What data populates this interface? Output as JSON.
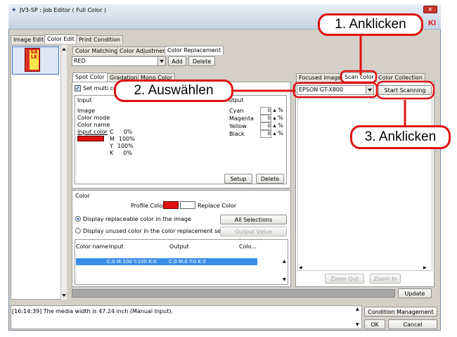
{
  "window": {
    "title": "JV3-SP : Job Editor ( Full Color )",
    "close_glyph": "✕",
    "logo": "KI"
  },
  "main_tabs": [
    "Image Edit",
    "Color Edit",
    "Print Condition"
  ],
  "thumbnail": {
    "text": "SALE"
  },
  "sub_tabs": [
    "Color Matching",
    "Color Adjustment",
    "Color Replacement"
  ],
  "replacement": {
    "selected": "RED",
    "add_label": "Add",
    "delete_label": "Delete"
  },
  "spot_tabs": [
    "Spot Color",
    "Gradation",
    "Mono Color"
  ],
  "set_multi": {
    "label": "Set multi co"
  },
  "input_group": {
    "title": "Input",
    "image_label": "Image",
    "mode_label": "Color mode",
    "name_label": "Color name",
    "input_color_label": "Input color",
    "cmyk": [
      {
        "c": "C",
        "v": "0%"
      },
      {
        "c": "M",
        "v": "100%"
      },
      {
        "c": "Y",
        "v": "100%"
      },
      {
        "c": "K",
        "v": "0%"
      }
    ]
  },
  "output_group": {
    "title": "utput",
    "rows": [
      {
        "label": "Cyan",
        "value": "0"
      },
      {
        "label": "Magenta",
        "value": "0"
      },
      {
        "label": "Yellow",
        "value": "0"
      },
      {
        "label": "Black",
        "value": "0"
      }
    ],
    "unit": "%",
    "setup_label": "Setup",
    "delete_label": "Delete"
  },
  "color_group": {
    "title": "Color",
    "profile_label": "Profile Color",
    "replace_label": "Replace Color",
    "radio1": "Display replaceable color in the image",
    "radio2": "Display unused color in the color replacement set",
    "all_selections_label": "All Selections",
    "output_value_label": "Output Value Acquisition",
    "columns": [
      "Color name",
      "Input",
      "Output",
      "Colo..."
    ],
    "row": {
      "input": "C:0 M:100 Y:100 K:0",
      "output": "C:0 M:0 Y:0 K:0"
    }
  },
  "right_tabs": [
    "Focused image",
    "Scan color",
    "Color Collection"
  ],
  "scanner": {
    "selected": "EPSON GT-X800",
    "start_label": "Start Scanning"
  },
  "zoom": {
    "out_label": "Zoom Out",
    "in_label": "Zoom In"
  },
  "update_label": "Update",
  "log_text": "[16:14:39] The media width is 47.24 inch (Manual Input).",
  "bottom_buttons": {
    "condition_label": "Condition Management",
    "ok_label": "OK",
    "cancel_label": "Cancel"
  },
  "callouts": {
    "c1": "1. Anklicken",
    "c2": "2. Auswählen",
    "c3": "3. Anklicken"
  },
  "colors": {
    "accent_red": "#e01010",
    "selection_blue": "#3a8ee8",
    "title_gradient": "#c6d3e3"
  }
}
